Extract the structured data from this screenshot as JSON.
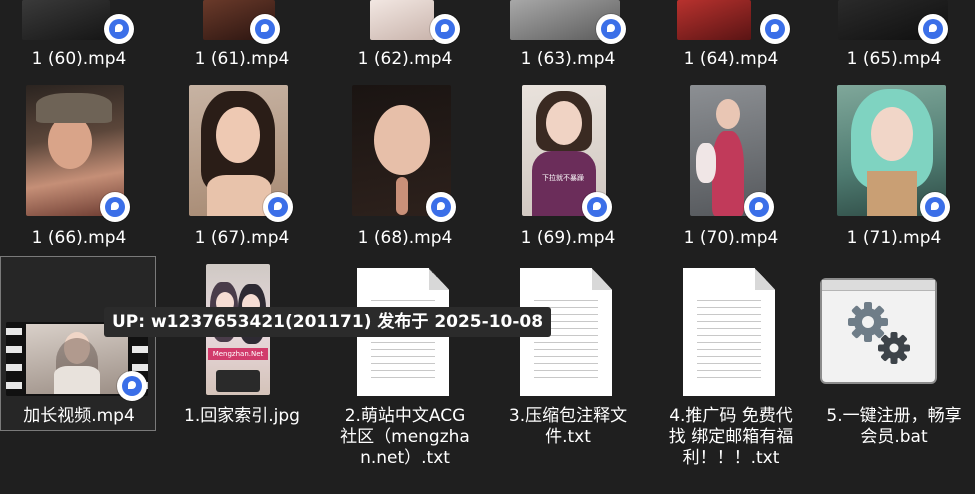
{
  "row1": [
    {
      "label": "1 (60).mp4"
    },
    {
      "label": "1 (61).mp4"
    },
    {
      "label": "1 (62).mp4"
    },
    {
      "label": "1 (63).mp4"
    },
    {
      "label": "1 (64).mp4"
    },
    {
      "label": "1 (65).mp4"
    }
  ],
  "row2": [
    {
      "label": "1 (66).mp4"
    },
    {
      "label": "1 (67).mp4"
    },
    {
      "label": "1 (68).mp4"
    },
    {
      "label": "1 (69).mp4",
      "overlay_text": "下拉就不暴躁"
    },
    {
      "label": "1 (70).mp4"
    },
    {
      "label": "1 (71).mp4"
    }
  ],
  "row3": [
    {
      "label": "加长视频.mp4"
    },
    {
      "label": "1.回家索引.jpg",
      "watermark": "Mengzhan.Net"
    },
    {
      "label": "2.萌站中文ACG社区（mengzhan.net）.txt"
    },
    {
      "label": "3.压缩包注释文件.txt"
    },
    {
      "label": "4.推广码 免费代找 绑定邮箱有福利！！！.txt"
    },
    {
      "label": "5.一键注册，畅享会员.bat"
    }
  ],
  "tooltip": "UP: w1237653421(201171) 发布于 2025-10-08",
  "icons": {
    "video_badge": "media-player-icon",
    "settings": "gears-icon",
    "film": "film-strip-icon"
  }
}
